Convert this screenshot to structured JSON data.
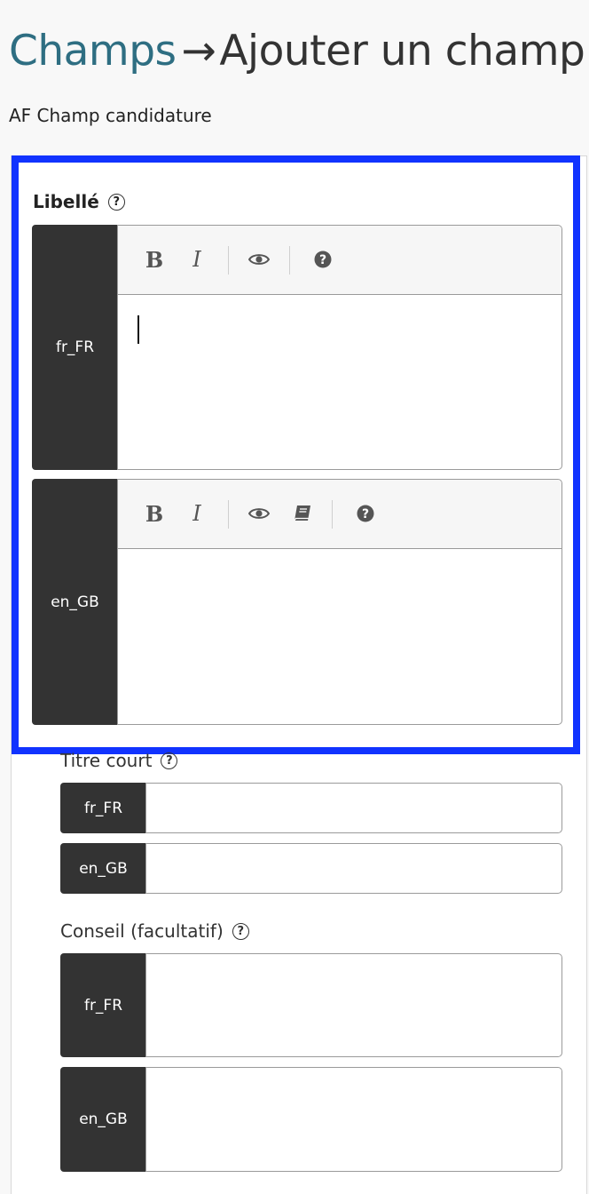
{
  "header": {
    "breadcrumb_link": "Champs",
    "arrow": "→",
    "page_title": "Ajouter un champ",
    "subtitle": "AF Champ candidature"
  },
  "libelle": {
    "label": "Libellé",
    "help": "?",
    "editors": [
      {
        "lang": "fr_FR",
        "toolbar": [
          "bold",
          "italic",
          "preview",
          "help"
        ],
        "value": ""
      },
      {
        "lang": "en_GB",
        "toolbar": [
          "bold",
          "italic",
          "preview",
          "glossary",
          "help"
        ],
        "value": ""
      }
    ],
    "bold_glyph": "B",
    "italic_glyph": "I"
  },
  "titre_court": {
    "label": "Titre court",
    "help": "?",
    "inputs": [
      {
        "lang": "fr_FR",
        "value": ""
      },
      {
        "lang": "en_GB",
        "value": ""
      }
    ]
  },
  "conseil": {
    "label": "Conseil (facultatif)",
    "help": "?",
    "inputs": [
      {
        "lang": "fr_FR",
        "value": ""
      },
      {
        "lang": "en_GB",
        "value": ""
      }
    ]
  },
  "colors": {
    "link": "#2e6e82",
    "highlight": "#1133ff",
    "lang_tag_bg": "#333333"
  }
}
